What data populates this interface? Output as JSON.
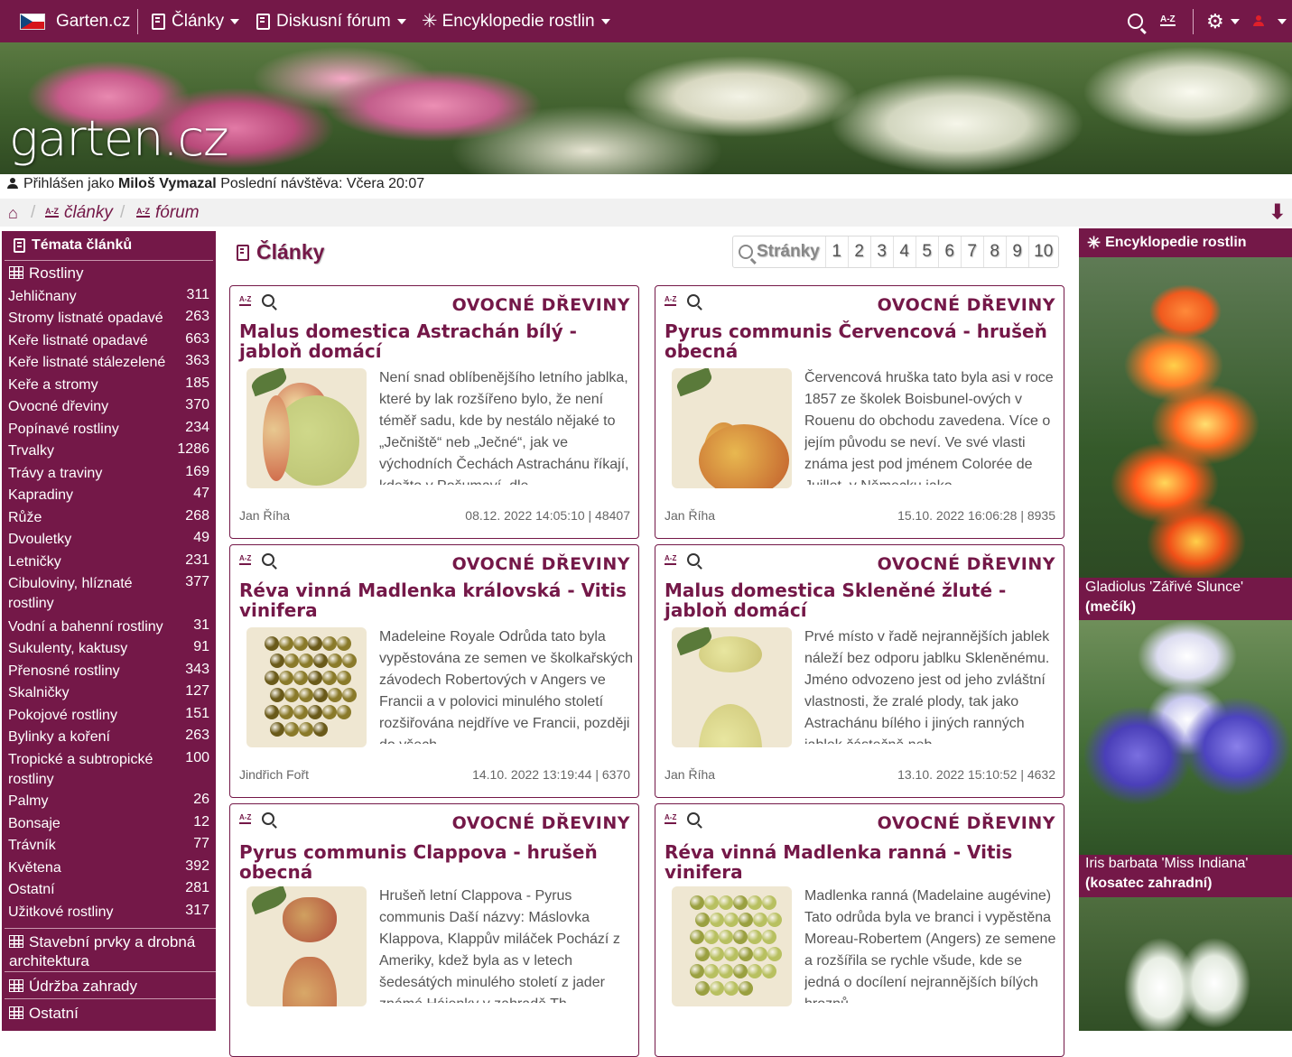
{
  "navbar": {
    "brand": "Garten.cz",
    "menu_articles": "Články",
    "menu_forum": "Diskusní fórum",
    "menu_encyclopedia": "Encyklopedie rostlin",
    "az_icon": "A-Z"
  },
  "banner": {
    "logo": "garten.cz"
  },
  "login": {
    "prefix": "Přihlášen jako",
    "user": "Miloš Vymazal",
    "last_visit": "Poslední návštěva: Včera 20:07"
  },
  "breadcrumb": {
    "az": "A-Z",
    "items": [
      "články",
      "fórum"
    ]
  },
  "sidebar": {
    "title": "Témata článků",
    "section_plants": "Rostliny",
    "items": [
      {
        "label": "Jehličnany",
        "count": "311"
      },
      {
        "label": "Stromy listnaté opadavé",
        "count": "263"
      },
      {
        "label": "Keře listnaté opadavé",
        "count": "663"
      },
      {
        "label": "Keře listnaté stálezelené",
        "count": "363"
      },
      {
        "label": "Keře a stromy",
        "count": "185"
      },
      {
        "label": "Ovocné dřeviny",
        "count": "370"
      },
      {
        "label": "Popínavé rostliny",
        "count": "234"
      },
      {
        "label": "Trvalky",
        "count": "1286"
      },
      {
        "label": "Trávy a traviny",
        "count": "169"
      },
      {
        "label": "Kapradiny",
        "count": "47"
      },
      {
        "label": "Růže",
        "count": "268"
      },
      {
        "label": "Dvouletky",
        "count": "49"
      },
      {
        "label": "Letničky",
        "count": "231"
      },
      {
        "label": "Cibuloviny, hlíznaté rostliny",
        "count": "377"
      },
      {
        "label": "Vodní a bahenní rostliny",
        "count": "31"
      },
      {
        "label": "Sukulenty, kaktusy",
        "count": "91"
      },
      {
        "label": "Přenosné rostliny",
        "count": "343"
      },
      {
        "label": "Skalničky",
        "count": "127"
      },
      {
        "label": "Pokojové rostliny",
        "count": "151"
      },
      {
        "label": "Bylinky a koření",
        "count": "263"
      },
      {
        "label": "Tropické a subtropické rostliny",
        "count": "100"
      },
      {
        "label": "Palmy",
        "count": "26"
      },
      {
        "label": "Bonsaje",
        "count": "12"
      },
      {
        "label": "Trávník",
        "count": "77"
      },
      {
        "label": "Květena",
        "count": "392"
      },
      {
        "label": "Ostatní",
        "count": "281"
      },
      {
        "label": "Užitkové rostliny",
        "count": "317"
      }
    ],
    "section_structures": "Stavební prvky a drobná architektura",
    "section_maintenance": "Údržba zahrady",
    "section_other": "Ostatní"
  },
  "main": {
    "title": "Články",
    "pager_label": "Stránky",
    "pages": [
      "1",
      "2",
      "3",
      "4",
      "5",
      "6",
      "7",
      "8",
      "9",
      "10"
    ]
  },
  "articles": [
    {
      "category": "OVOCNÉ DŘEVINY",
      "title": "Malus domestica Astrachán bílý - jabloň domácí",
      "snippet": "Není snad oblíbenějšího letního jablka, které by lak rozšířeno bylo, že není téměř sadu, kde by nestálo nějaké to „Ječniště“ neb „Ječné“, jak ve východních Čechách Astrachánu říkají, kdežto v Pošumaví, dle",
      "author": "Jan Říha",
      "meta": "08.12. 2022 14:05:10 | 48407"
    },
    {
      "category": "OVOCNÉ DŘEVINY",
      "title": "Pyrus communis Červencová - hrušeň obecná",
      "snippet": "Červencová hruška tato byla asi v roce 1857 ze školek Boisbunel-ových v Rouenu do obchodu zavedena. Více o jejím původu se neví. Ve své vlasti známa jest pod jménem Colorée de Juillet, v Německu jako",
      "author": "Jan Říha",
      "meta": "15.10. 2022 16:06:28 | 8935"
    },
    {
      "category": "OVOCNÉ DŘEVINY",
      "title": "Réva vinná Madlenka královská - Vitis vinifera",
      "snippet": "Madeleine Royale Odrůda tato byla vypěstována ze semen ve školkařských závodech Robertových v Angers ve Francii a v polovici minulého století rozšiřována nejdříve ve Francii, později do všech",
      "author": "Jindřich Fořt",
      "meta": "14.10. 2022 13:19:44 | 6370"
    },
    {
      "category": "OVOCNÉ DŘEVINY",
      "title": "Malus domestica Skleněné žluté - jabloň domácí",
      "snippet": "Prvé místo v řadě nejrannějších jablek náleží bez odporu jablku Skleněnému. Jméno odvozeno jest od jeho zvláštní vlastnosti, že zralé plody, tak jako Astrachánu bílého i jiných ranných jablek částečně neb",
      "author": "Jan Říha",
      "meta": "13.10. 2022 15:10:52 | 4632"
    },
    {
      "category": "OVOCNÉ DŘEVINY",
      "title": "Pyrus communis Clappova - hrušeň obecná",
      "snippet": "Hrušeň letní Clappova - Pyrus communis Daší názvy: Máslovka Klappova, Klappův miláček Pochází z Ameriky, kdež byla as v letech šedesátých minulého století z jader známé Hájenky v zahradě Th.",
      "author": "",
      "meta": ""
    },
    {
      "category": "OVOCNÉ DŘEVINY",
      "title": "Réva vinná Madlenka ranná - Vitis vinifera",
      "snippet": "Madlenka ranná (Madelaine augévine) Tato odrůda byla ve branci i vypěstěna Moreau-Robertem (Angers) ze semene a rozšířila se rychle všude, kde se jedná o docílení nejrannějších bílých hroznů",
      "author": "",
      "meta": ""
    }
  ],
  "encyclopedia": {
    "title": "Encyklopedie rostlin",
    "plants": [
      {
        "name": "Gladiolus 'Zářivé Slunce'",
        "common": "(mečík)"
      },
      {
        "name": "Iris barbata 'Miss Indiana'",
        "common": "(kosatec zahradní)"
      }
    ]
  },
  "colors": {
    "brand": "#741848",
    "breadcrumb_bg": "#f1f1f1"
  }
}
